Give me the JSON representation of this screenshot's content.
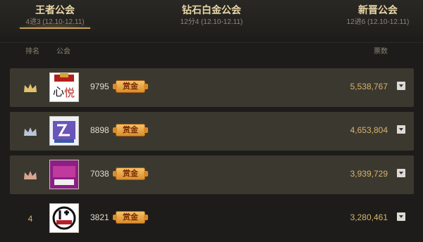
{
  "tabs": [
    {
      "title": "王者公会",
      "subtitle": "4进3 (12.10-12.11)"
    },
    {
      "title": "钻石白金公会",
      "subtitle": "12分4 (12.10-12.11)"
    },
    {
      "title": "新晋公会",
      "subtitle": "12进6 (12.10-12.11)"
    }
  ],
  "columns": {
    "rank": "排名",
    "guild": "公会",
    "votes": "票数"
  },
  "rows": [
    {
      "rank": "",
      "crown": "gold-crown-icon",
      "count": "9795",
      "badge": "赏金",
      "votes": "5,538,767"
    },
    {
      "rank": "",
      "crown": "silver-crown-icon",
      "count": "8898",
      "badge": "赏金",
      "votes": "4,653,804"
    },
    {
      "rank": "",
      "crown": "bronze-crown-icon",
      "count": "7038",
      "badge": "赏金",
      "votes": "3,939,729"
    },
    {
      "rank": "4",
      "crown": "",
      "count": "3821",
      "badge": "赏金",
      "votes": "3,280,461"
    }
  ],
  "colors": {
    "gold": "#e3c36a",
    "silver": "#b9c5d8",
    "bronze": "#d9a58e",
    "accent": "#c7a15a"
  }
}
